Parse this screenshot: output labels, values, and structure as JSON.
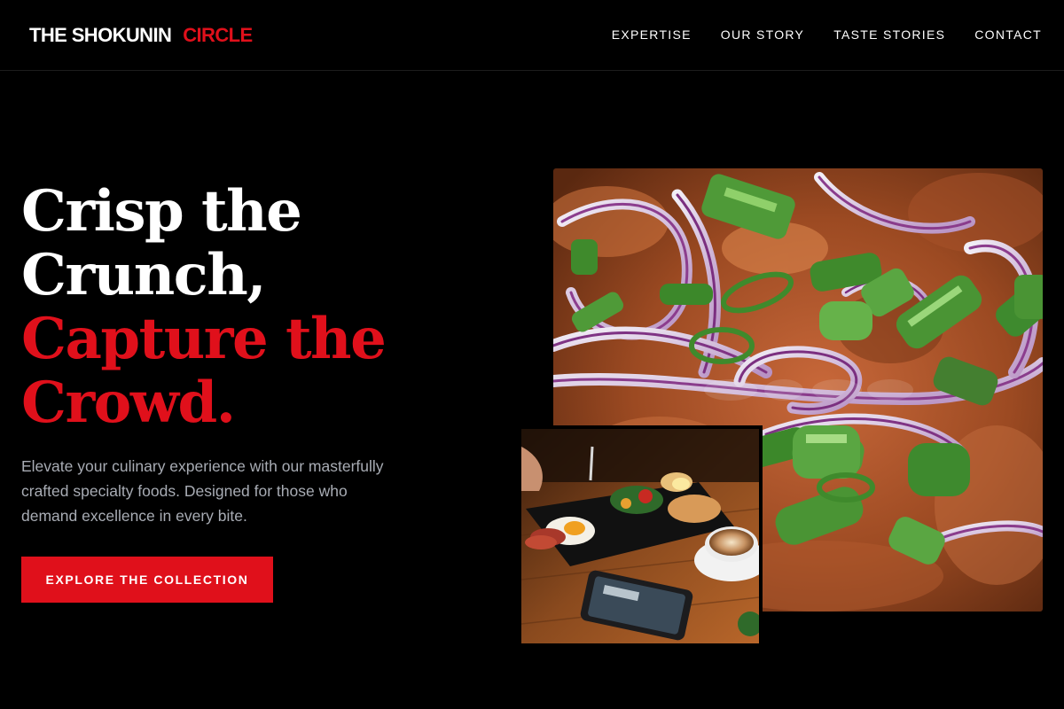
{
  "header": {
    "brand_part1": "THE SHOKUNIN",
    "brand_part2": "CIRCLE",
    "nav": [
      "EXPERTISE",
      "OUR STORY",
      "TASTE STORIES",
      "CONTACT"
    ]
  },
  "hero": {
    "headline": [
      "Crisp the",
      "Crunch,",
      "Capture the",
      "Crowd."
    ],
    "description": "Elevate your culinary experience with our masterfully crafted specialty foods. Designed for those who demand excellence in every bite.",
    "cta_label": "EXPLORE THE COLLECTION"
  },
  "colors": {
    "background": "#000000",
    "accent_red": "#e0101b",
    "description_gray": "#a8acb4"
  }
}
